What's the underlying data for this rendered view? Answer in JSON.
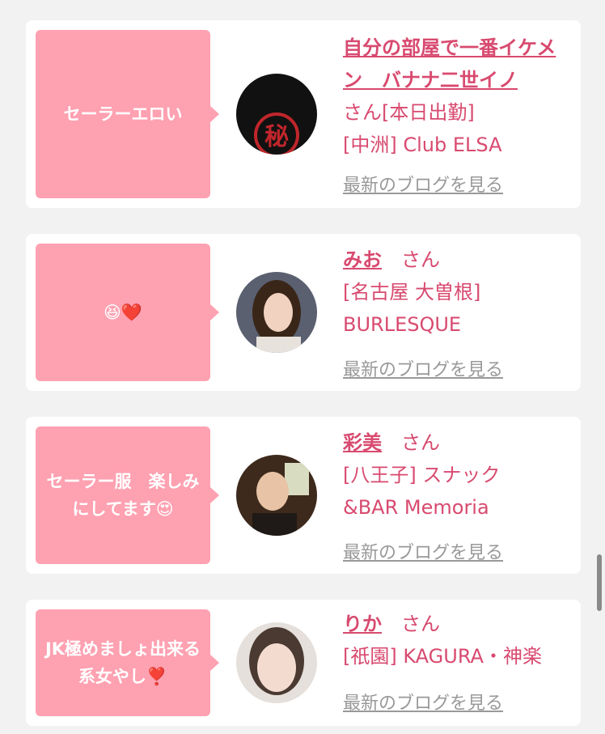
{
  "cards": [
    {
      "message": "セーラーエロい",
      "name": "自分の部屋で一番イケメン　バナナ二世イノ",
      "suffix": "さん[本日出勤]",
      "shop": "[中洲] Club ELSA",
      "blog_link": "最新のブログを見る"
    },
    {
      "message": "😆❤️",
      "name": "みお",
      "suffix": "　さん",
      "shop": "[名古屋 大曽根] BURLESQUE",
      "blog_link": "最新のブログを見る"
    },
    {
      "message": "セーラー服　楽しみにしてます😍",
      "name": "彩美",
      "suffix": "　さん",
      "shop": "[八王子] スナック&BAR Memoria",
      "blog_link": "最新のブログを見る"
    },
    {
      "message": "JK極めましょ出来る系女やし❣️",
      "name": "りか",
      "suffix": "　さん",
      "shop": "[祇園] KAGURA・神楽",
      "blog_link": "最新のブログを見る"
    }
  ]
}
